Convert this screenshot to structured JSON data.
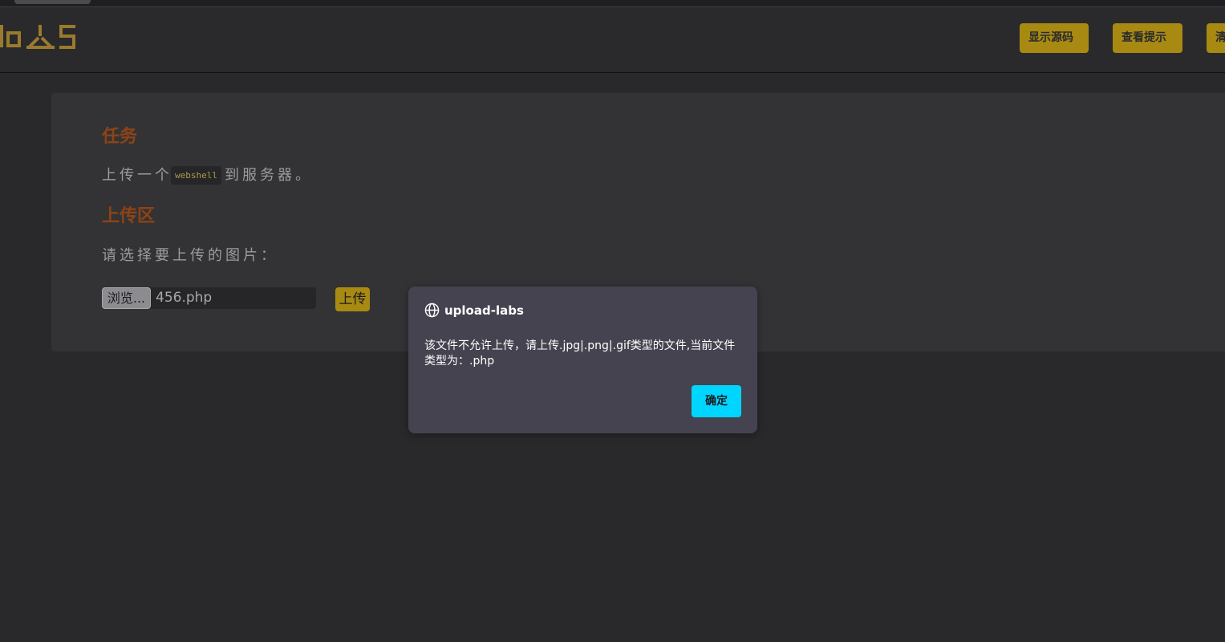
{
  "header": {
    "logo_text": "UPLOAD-LABS",
    "buttons": [
      "显示源码",
      "查看提示",
      "清"
    ]
  },
  "task": {
    "heading": "任务",
    "desc_before": "上传一个",
    "desc_code": "webshell",
    "desc_after": "到服务器。"
  },
  "upload_area": {
    "heading": "上传区",
    "prompt": "请选择要上传的图片：",
    "browse_label": "浏览...",
    "file_name": "456.php",
    "upload_label": "上传"
  },
  "dialog": {
    "icon": "globe-icon",
    "title": "upload-labs",
    "message": "该文件不允许上传，请上传.jpg|.png|.gif类型的文件,当前文件类型为：.php",
    "ok_label": "确定"
  },
  "colors": {
    "accent_gold": "#a88a12",
    "heading_orange": "#8e4314",
    "dialog_button": "#00d5ff"
  }
}
